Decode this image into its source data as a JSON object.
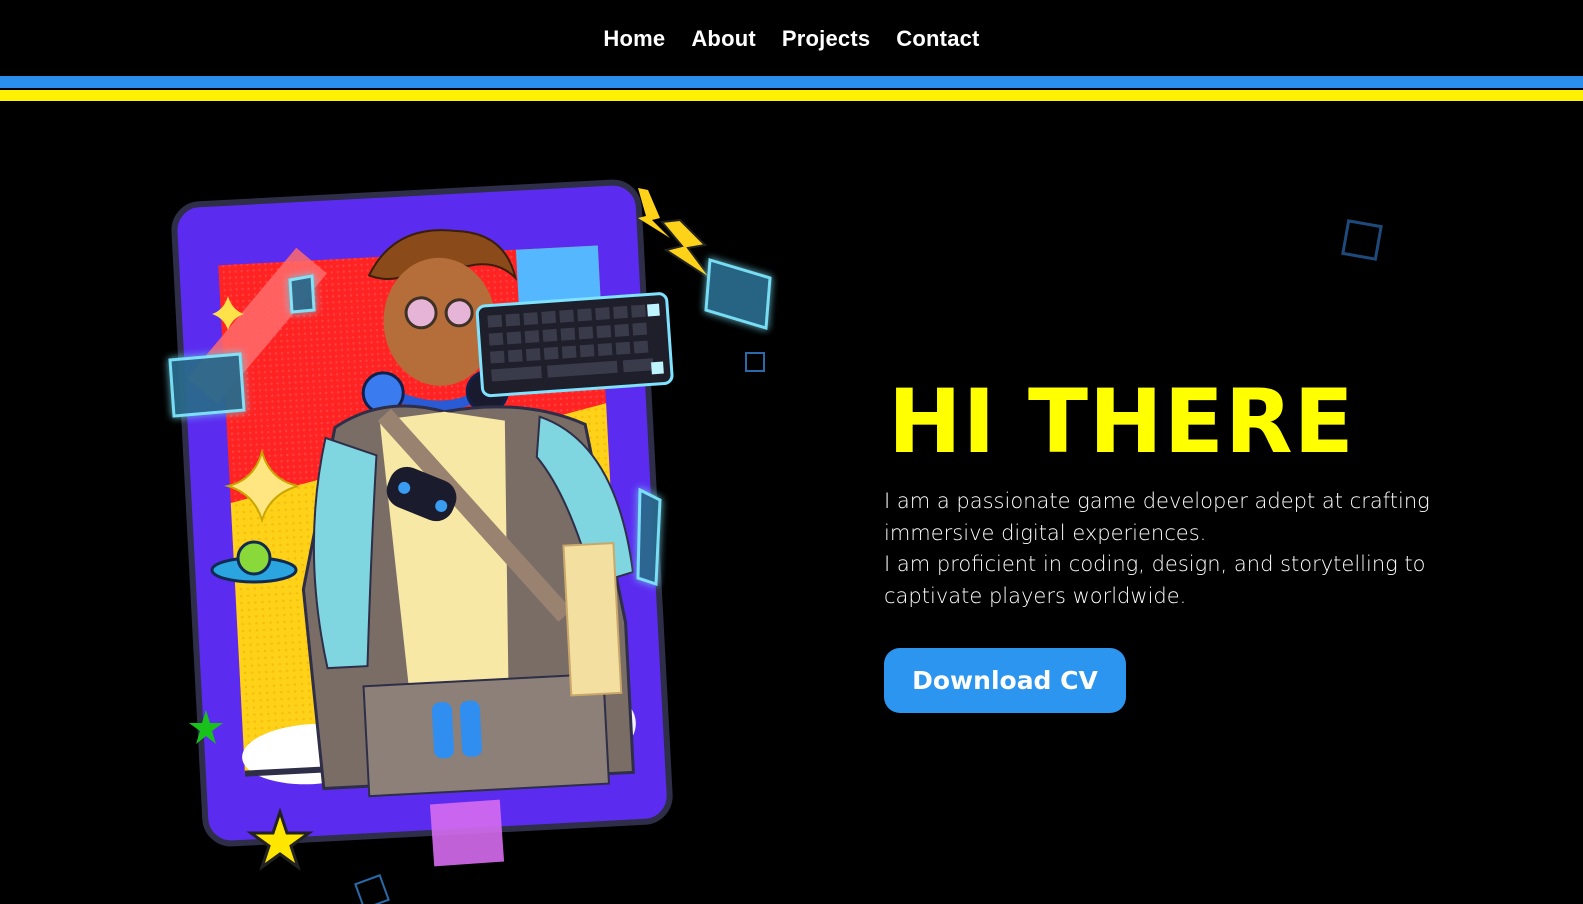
{
  "nav": {
    "items": [
      {
        "label": "Home"
      },
      {
        "label": "About"
      },
      {
        "label": "Projects"
      },
      {
        "label": "Contact"
      }
    ]
  },
  "colors": {
    "background": "#000000",
    "stripe_blue": "#2b8eec",
    "stripe_yellow": "#fff200",
    "title": "#ffff00",
    "button": "#2b95f0",
    "card_purple": "#5b2cf0"
  },
  "hero": {
    "title": "HI THERE",
    "description_lines": [
      "I am a passionate game developer adept at crafting immersive digital experiences.",
      "I am proficient in coding, design, and storytelling to captivate players worldwide."
    ],
    "cta_label": "Download CV"
  },
  "illustration": {
    "icons": [
      "lightning-bolt-icon",
      "star-icon",
      "sparkle-icon",
      "ufo-icon",
      "keyboard-icon",
      "headphones-icon",
      "gamepad-icon"
    ]
  }
}
